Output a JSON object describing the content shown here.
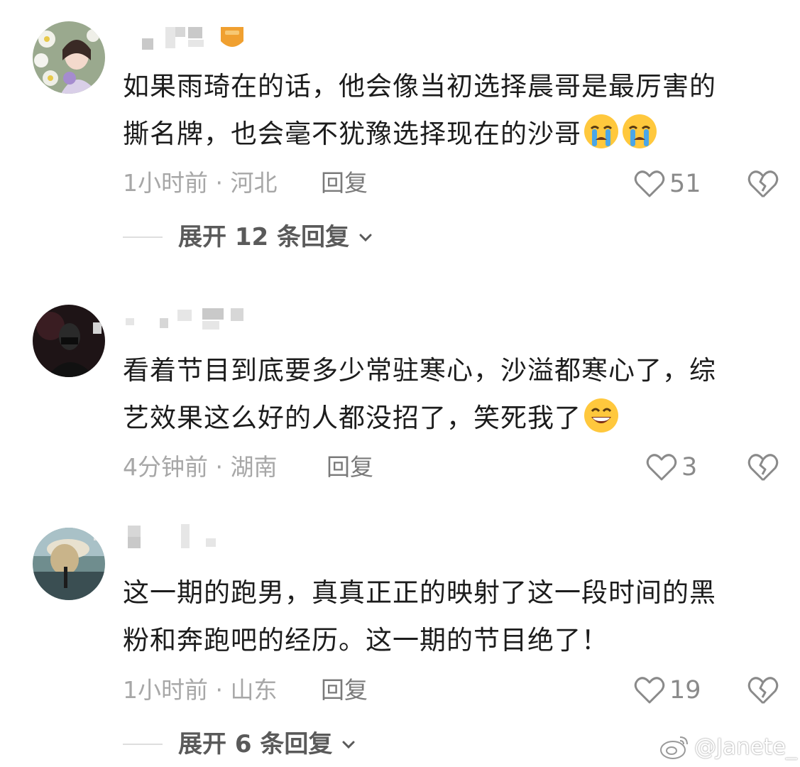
{
  "comments": [
    {
      "text_line1": "如果雨琦在的话，他会像当初选择晨哥是最厉害的",
      "text_line2": "撕名牌，也会毫不犹豫选择现在的沙哥",
      "emojis": [
        "loudly-crying-face-emoji",
        "loudly-crying-face-emoji"
      ],
      "time_location": "1小时前 · 河北",
      "reply_label": "回复",
      "likes": "51",
      "expand_label": "展开 12 条回复"
    },
    {
      "text_line1": "看着节目到底要多少常驻寒心，沙溢都寒心了，综",
      "text_line2": "艺效果这么好的人都没招了，笑死我了",
      "emojis": [
        "grinning-face-emoji"
      ],
      "time_location": "4分钟前 · 湖南",
      "reply_label": "回复",
      "likes": "3"
    },
    {
      "text_line1": "这一期的跑男，真真正正的映射了这一段时间的黑",
      "text_line2": "粉和奔跑吧的经历。这一期的节目绝了！",
      "time_location": "1小时前 · 山东",
      "reply_label": "回复",
      "likes": "19",
      "expand_label": "展开 6 条回复"
    }
  ],
  "watermark": {
    "text": "@Janete_",
    "icon": "weibo-icon"
  },
  "colors": {
    "meta": "#a7a7a7",
    "reply": "#7a7a7a",
    "badge": "#f0a030",
    "emoji_face": "#ffc83d",
    "tears": "#4aa6e8"
  }
}
